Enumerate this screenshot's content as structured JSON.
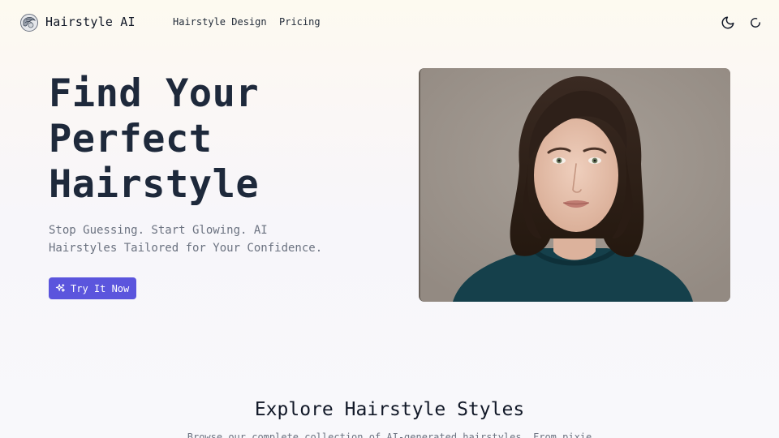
{
  "header": {
    "brand": "Hairstyle AI",
    "nav": [
      {
        "label": "Hairstyle Design"
      },
      {
        "label": "Pricing"
      }
    ],
    "icons": {
      "logo": "hairstyle-logo-icon",
      "theme": "moon-icon",
      "loading": "loading-spinner-icon"
    }
  },
  "hero": {
    "title_line1": "Find Your",
    "title_line2": "Perfect",
    "title_line3": "Hairstyle",
    "subtitle": "Stop Guessing. Start Glowing. AI Hairstyles Tailored for Your Confidence.",
    "cta_label": "Try It Now",
    "cta_icon": "sparkles-icon"
  },
  "section": {
    "title": "Explore Hairstyle Styles",
    "description": "Browse our complete collection of AI-generated hairstyles. From pixie"
  },
  "colors": {
    "accent": "#5b55dd",
    "heading": "#1e293b",
    "muted": "#6b7280"
  }
}
